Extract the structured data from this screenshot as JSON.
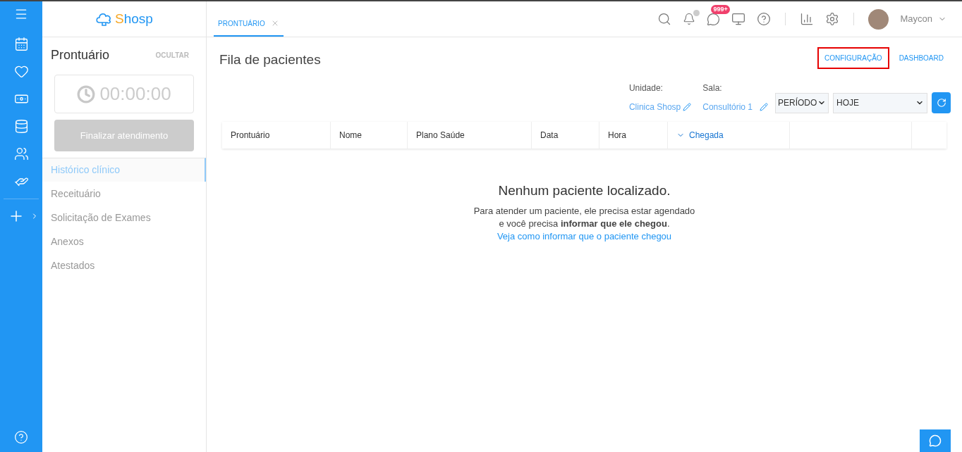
{
  "logo": {
    "first": "S",
    "rest": "hosp"
  },
  "panel": {
    "title": "Prontuário",
    "hide": "OCULTAR",
    "timer": "00:00:00",
    "finish_button": {
      "label": "Finalizar atendimento",
      "disabled": true
    },
    "items": [
      {
        "label": "Histórico clínico",
        "selected": true
      },
      {
        "label": "Receituário",
        "selected": false
      },
      {
        "label": "Solicitação de Exames",
        "selected": false
      },
      {
        "label": "Anexos",
        "selected": false
      },
      {
        "label": "Atestados",
        "selected": false
      }
    ]
  },
  "tabs": [
    {
      "label": "PRONTUÁRIO",
      "selected": true
    }
  ],
  "header": {
    "messages_badge": "999+",
    "user": "Maycon"
  },
  "page_title": "Fila de pacientes",
  "links": [
    {
      "label": "CONFIGURAÇÃO",
      "highlighted": true
    },
    {
      "label": "DASHBOARD",
      "highlighted": false
    }
  ],
  "filters": {
    "unit_label": "Unidade:",
    "unit_value": "Clinica Shosp",
    "room_label": "Sala:",
    "room_value": "Consultório 1",
    "period": "PERÍODO",
    "range": "HOJE"
  },
  "table": {
    "columns": [
      {
        "label": "Prontuário",
        "sorted": false
      },
      {
        "label": "Nome",
        "sorted": false
      },
      {
        "label": "Plano Saúde",
        "sorted": false
      },
      {
        "label": "Data",
        "sorted": false
      },
      {
        "label": "Hora",
        "sorted": false
      },
      {
        "label": "Chegada",
        "sorted": true
      }
    ]
  },
  "empty": {
    "title": "Nenhum paciente localizado.",
    "lines": [
      "Para atender um paciente, ele precisa estar agendado",
      "e você precisa **informar que ele chegou**."
    ],
    "link": "Veja como informar que o paciente chegou"
  }
}
